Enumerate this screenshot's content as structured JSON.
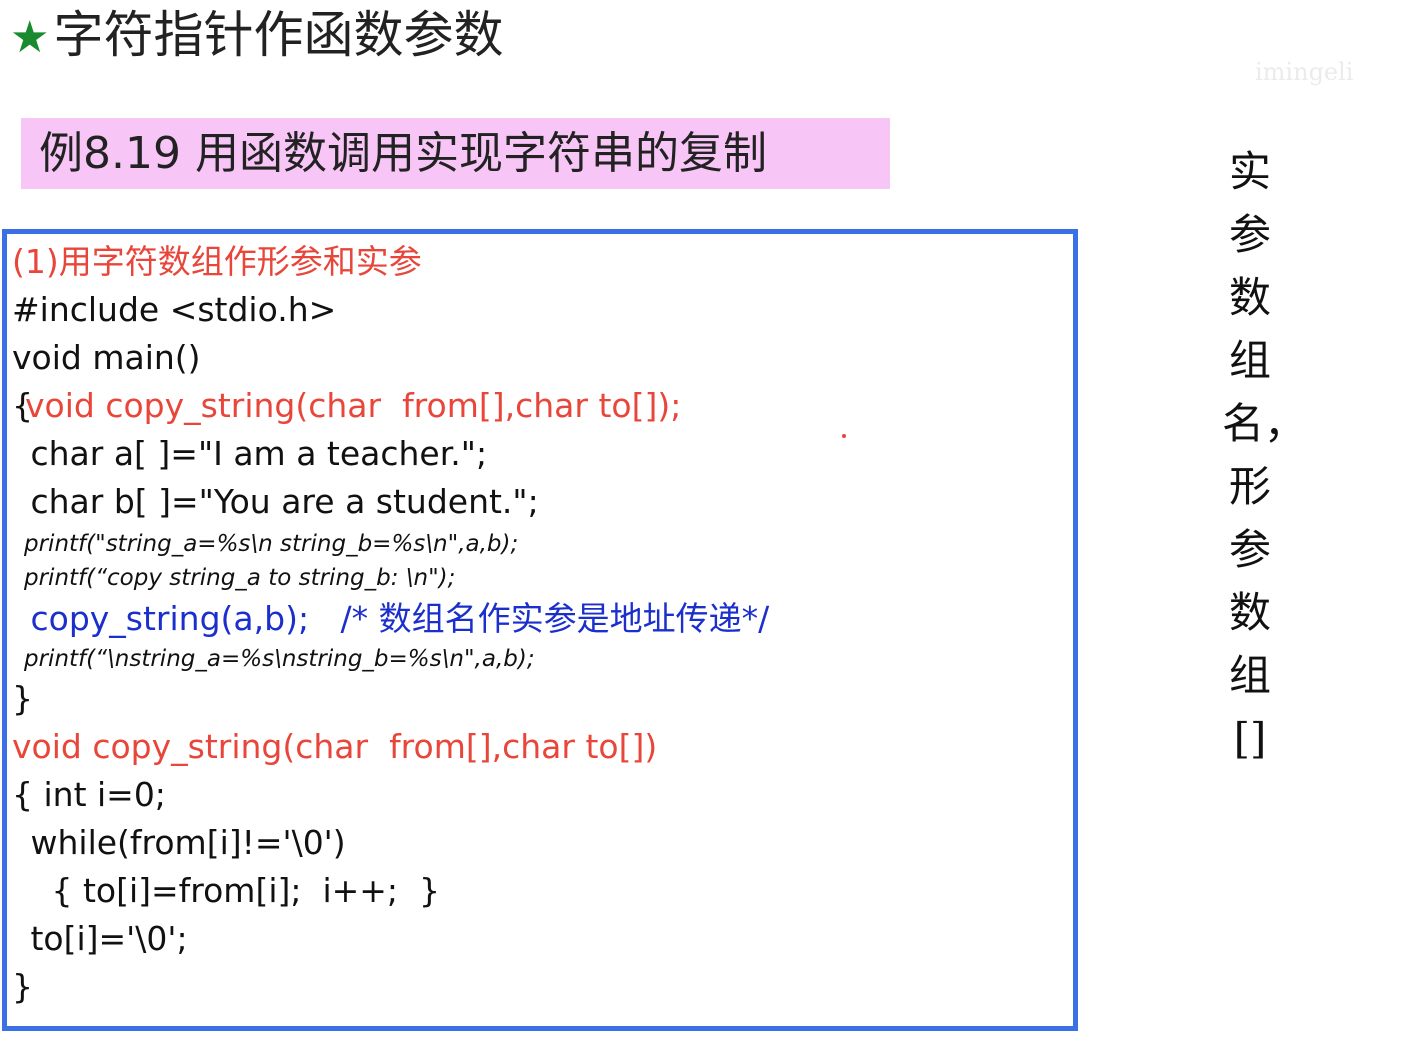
{
  "title": {
    "star": "★",
    "text": "字符指针作函数参数"
  },
  "example": {
    "label": "例8.19   用函数调用实现字符串的复制"
  },
  "code": {
    "heading": "(1)用字符数组作形参和实参",
    "lines": [
      "#include <stdio.h>",
      "void main()",
      "{",
      "void copy_string(char  from[],char to[]);",
      " char a[ ]=\"I am a teacher.\";",
      " char b[ ]=\"You are a student.\";",
      "printf(\"string_a=%s\\n string_b=%s\\n\",a,b);",
      "printf(“copy string_a to string_b: \\n\");",
      " copy_string(a,b);   /* 数组名作实参是地址传递*/",
      "printf(“\\nstring_a=%s\\nstring_b=%s\\n\",a,b);",
      "}",
      "void copy_string(char  from[],char to[])",
      "{ int i=0;",
      " while(from[i]!='\\0')",
      "   { to[i]=from[i];  i++;  }",
      " to[i]='\\0';",
      "}"
    ]
  },
  "side_note": "实参数组名，形参数组[]",
  "watermark": "imingeli"
}
